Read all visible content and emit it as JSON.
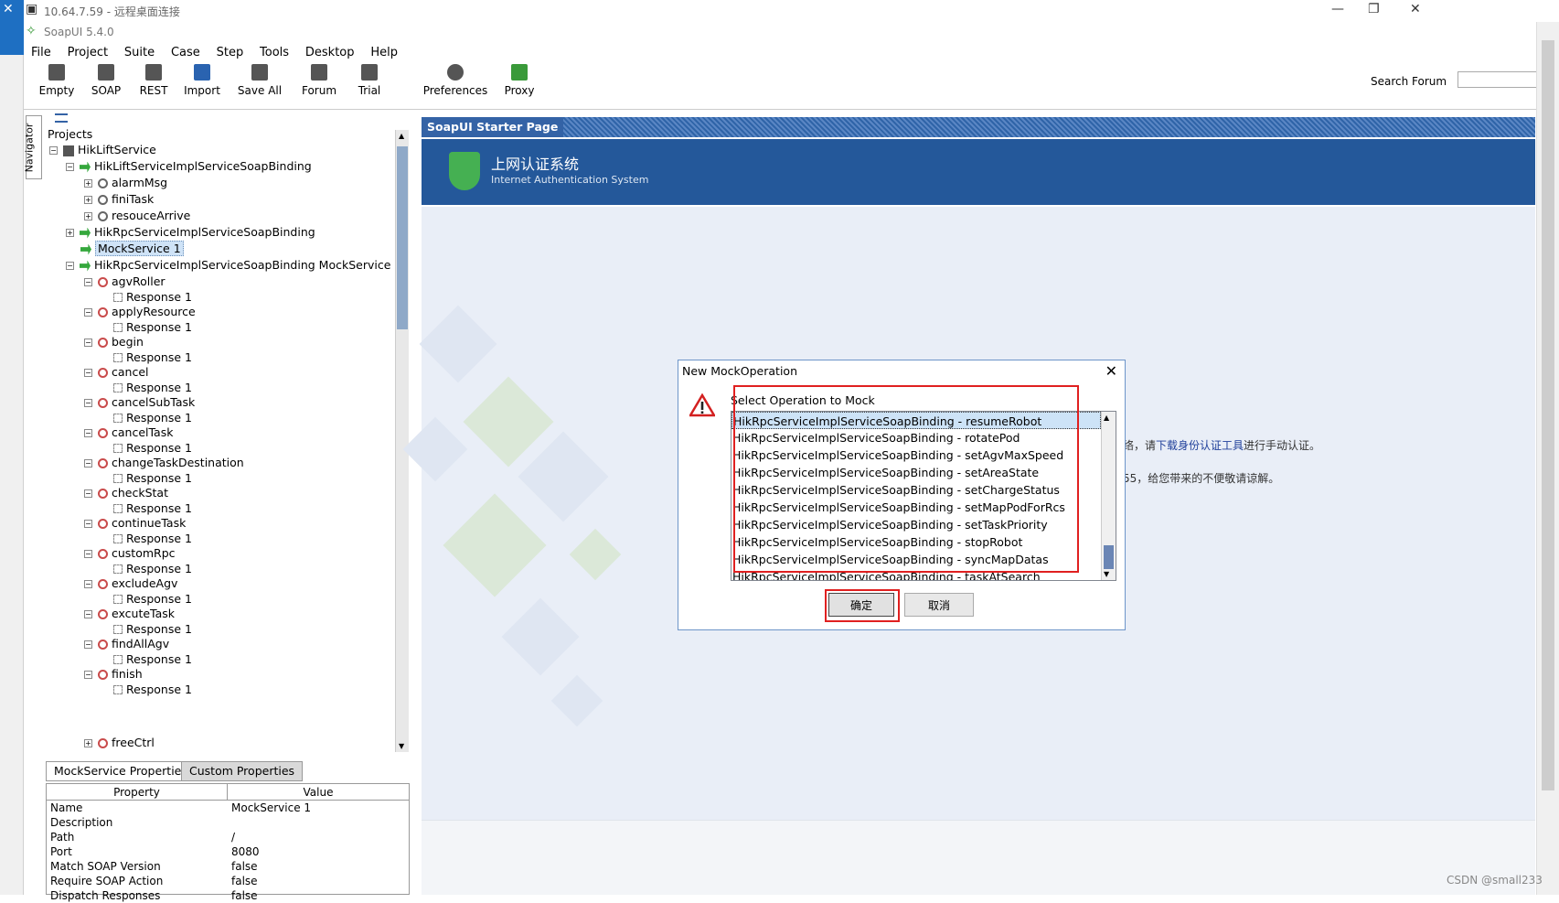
{
  "rdp": {
    "title": "10.64.7.59 - 远程桌面连接"
  },
  "app": {
    "title": "SoapUI 5.4.0"
  },
  "menu": [
    "File",
    "Project",
    "Suite",
    "Case",
    "Step",
    "Tools",
    "Desktop",
    "Help"
  ],
  "toolbar": {
    "buttons": [
      {
        "label": "Empty",
        "icon": "empty-project-icon"
      },
      {
        "label": "SOAP",
        "icon": "soap-icon"
      },
      {
        "label": "REST",
        "icon": "rest-icon"
      },
      {
        "label": "Import",
        "icon": "import-icon"
      },
      {
        "label": "Save All",
        "icon": "save-all-icon"
      },
      {
        "label": "Forum",
        "icon": "forum-icon"
      },
      {
        "label": "Trial",
        "icon": "trial-icon"
      },
      {
        "label": "Preferences",
        "icon": "gear-icon"
      },
      {
        "label": "Proxy",
        "icon": "proxy-icon"
      }
    ],
    "search_label": "Search Forum",
    "search_value": ""
  },
  "navigator": {
    "label": "Navigator"
  },
  "tree": {
    "root": "Projects",
    "project": "HikLiftService",
    "binding1": "HikLiftServiceImplServiceSoapBinding",
    "binding1_ops": [
      "alarmMsg",
      "finiTask",
      "resouceArrive"
    ],
    "binding2": "HikRpcServiceImplServiceSoapBinding",
    "mock1": "MockService 1",
    "mock2": "HikRpcServiceImplServiceSoapBinding MockService",
    "mock_ops": [
      "agvRoller",
      "applyResource",
      "begin",
      "cancel",
      "cancelSubTask",
      "cancelTask",
      "changeTaskDestination",
      "checkStat",
      "continueTask",
      "customRpc",
      "excludeAgv",
      "excuteTask",
      "findAllAgv",
      "finish"
    ],
    "response_label": "Response 1",
    "partial_item": "freeCtrl"
  },
  "props": {
    "tabs": [
      "MockService Properties",
      "Custom Properties"
    ],
    "headers": [
      "Property",
      "Value"
    ],
    "rows": [
      {
        "k": "Name",
        "v": "MockService 1"
      },
      {
        "k": "Description",
        "v": ""
      },
      {
        "k": "Path",
        "v": "/"
      },
      {
        "k": "Port",
        "v": "8080"
      },
      {
        "k": "Match SOAP Version",
        "v": "false"
      },
      {
        "k": "Require SOAP Action",
        "v": "false"
      },
      {
        "k": "Dispatch Responses",
        "v": "false"
      }
    ]
  },
  "starter": {
    "tab": "SoapUI Starter Page",
    "banner_title": "上网认证系统",
    "banner_subtitle": "Internet Authentication System",
    "notice1_pre": "络，请",
    "notice1_link": "下载身份认证工具",
    "notice1_post": "进行手动认证。",
    "notice2": "55，给您带来的不便敬请谅解。"
  },
  "dialog": {
    "title": "New MockOperation",
    "label": "Select Operation to Mock",
    "operations": [
      "HikRpcServiceImplServiceSoapBinding - resumeRobot",
      "HikRpcServiceImplServiceSoapBinding - rotatePod",
      "HikRpcServiceImplServiceSoapBinding - setAgvMaxSpeed",
      "HikRpcServiceImplServiceSoapBinding - setAreaState",
      "HikRpcServiceImplServiceSoapBinding - setChargeStatus",
      "HikRpcServiceImplServiceSoapBinding - setMapPodForRcs",
      "HikRpcServiceImplServiceSoapBinding - setTaskPriority",
      "HikRpcServiceImplServiceSoapBinding - stopRobot",
      "HikRpcServiceImplServiceSoapBinding - syncMapDatas",
      "HikRpcServiceImplServiceSoapBinding - taskAtSearch"
    ],
    "ok": "确定",
    "cancel": "取消"
  },
  "watermark": "CSDN @small233"
}
